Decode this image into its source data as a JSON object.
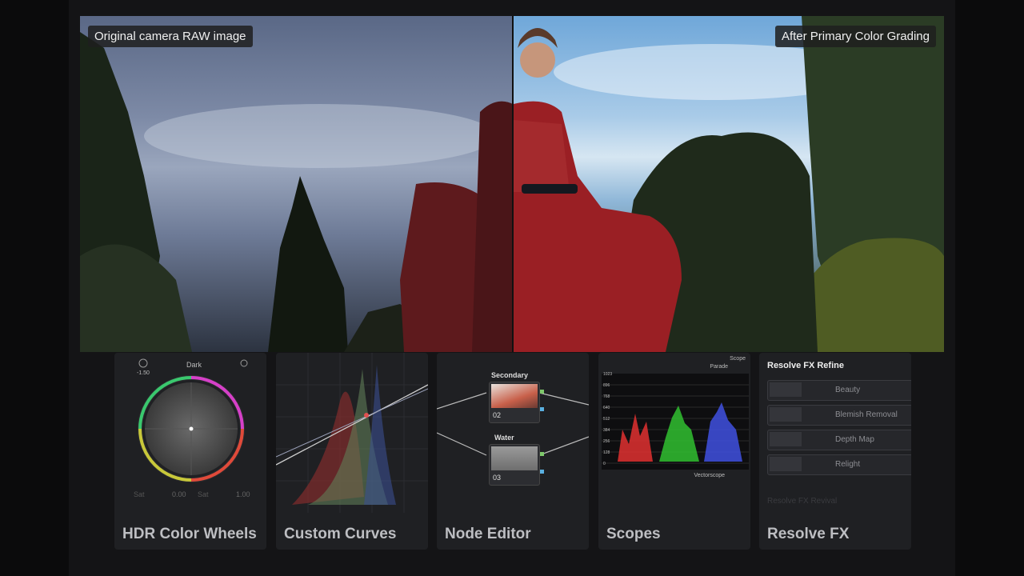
{
  "hero": {
    "left_label": "Original camera RAW image",
    "right_label": "After Primary Color Grading"
  },
  "panels": {
    "color_wheels": {
      "title": "HDR Color Wheels",
      "wheel_label": "Dark",
      "value_left": "-1.50",
      "sat_label": "Sat",
      "sat_value": "0.00",
      "sat_label2": "Sat",
      "sat_value2": "1.00"
    },
    "curves": {
      "title": "Custom Curves"
    },
    "node_editor": {
      "title": "Node Editor",
      "node1_label": "Secondary",
      "node1_id": "02",
      "node2_label": "Water",
      "node2_id": "03"
    },
    "scopes": {
      "title": "Scopes",
      "header": "Scope",
      "mode": "Parade",
      "footer": "Vectorscope",
      "y_ticks": [
        "1023",
        "896",
        "768",
        "640",
        "512",
        "384",
        "256",
        "128",
        "0"
      ]
    },
    "resolve_fx": {
      "title": "Resolve FX",
      "header": "Resolve FX Refine",
      "items": [
        "Beauty",
        "Blemish Removal",
        "Depth Map",
        "Relight"
      ],
      "faded": "Resolve FX Revival"
    }
  }
}
